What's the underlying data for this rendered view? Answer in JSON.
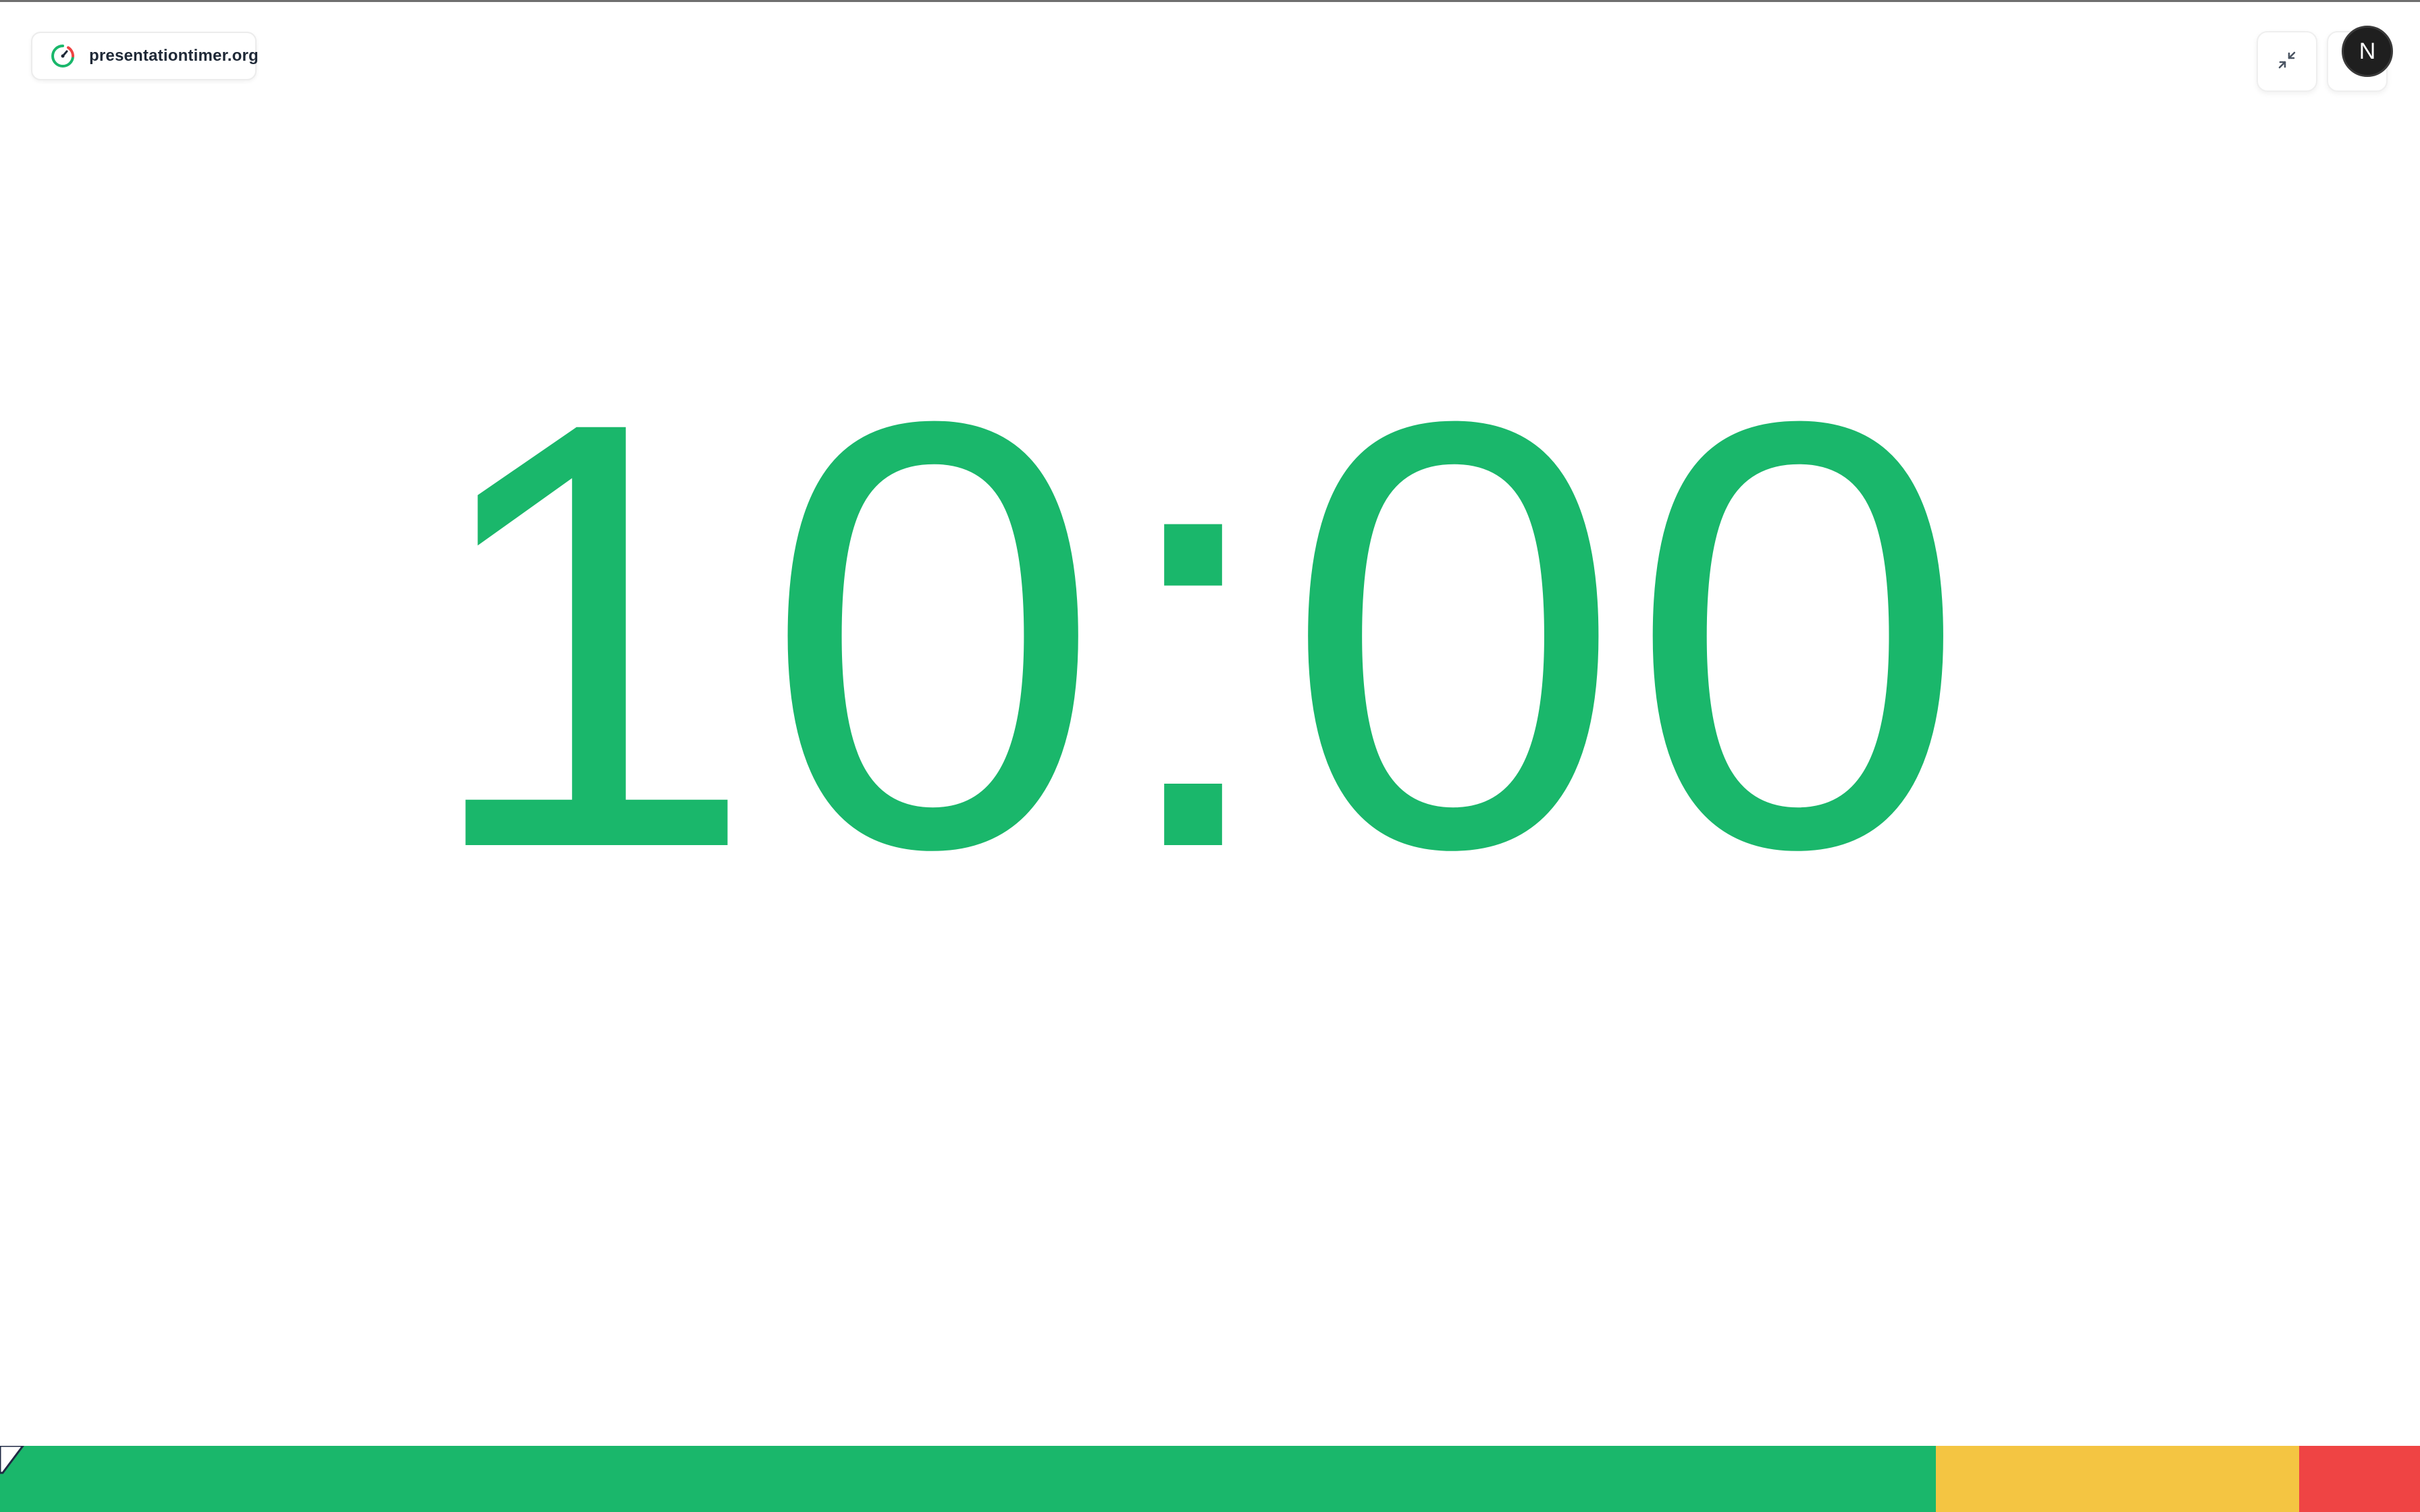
{
  "brand": {
    "name": "presentationtimer.org",
    "icon": "timer-gauge-icon"
  },
  "timer": {
    "display": "10:00",
    "color": "#1ab76b"
  },
  "controls": {
    "collapse_icon": "collapse-arrows-icon",
    "avatar_letter": "N"
  },
  "progress": {
    "segments": [
      {
        "phase": "green",
        "color": "#1ab76b",
        "fraction": 0.8
      },
      {
        "phase": "yellow",
        "color": "#f4c542",
        "fraction": 0.15
      },
      {
        "phase": "red",
        "color": "#ef4444",
        "fraction": 0.05
      }
    ],
    "elapsed_fraction": 0.0
  }
}
